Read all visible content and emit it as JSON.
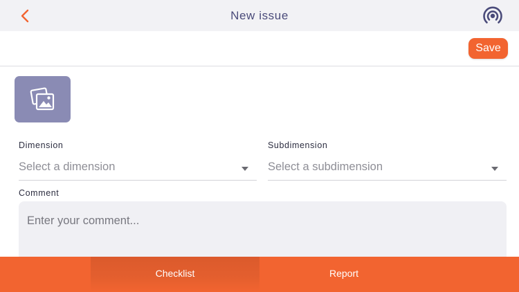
{
  "header": {
    "title": "New issue",
    "back_icon": "chevron-left-icon",
    "signal_icon": "broadcast-signal-icon"
  },
  "toolbar": {
    "save_label": "Save"
  },
  "photo": {
    "icon": "photo-stack-icon"
  },
  "form": {
    "dimension": {
      "label": "Dimension",
      "placeholder": "Select a dimension"
    },
    "subdimension": {
      "label": "Subdimension",
      "placeholder": "Select a subdimension"
    },
    "comment": {
      "label": "Comment",
      "placeholder": "Enter your comment..."
    }
  },
  "tabs": [
    {
      "label": "Checklist",
      "active": true
    },
    {
      "label": "Report",
      "active": false
    }
  ],
  "colors": {
    "accent": "#f26430",
    "title": "#4a4b7a",
    "photo_tile": "#8a8bb4",
    "header_bg": "#f2f2f5"
  }
}
